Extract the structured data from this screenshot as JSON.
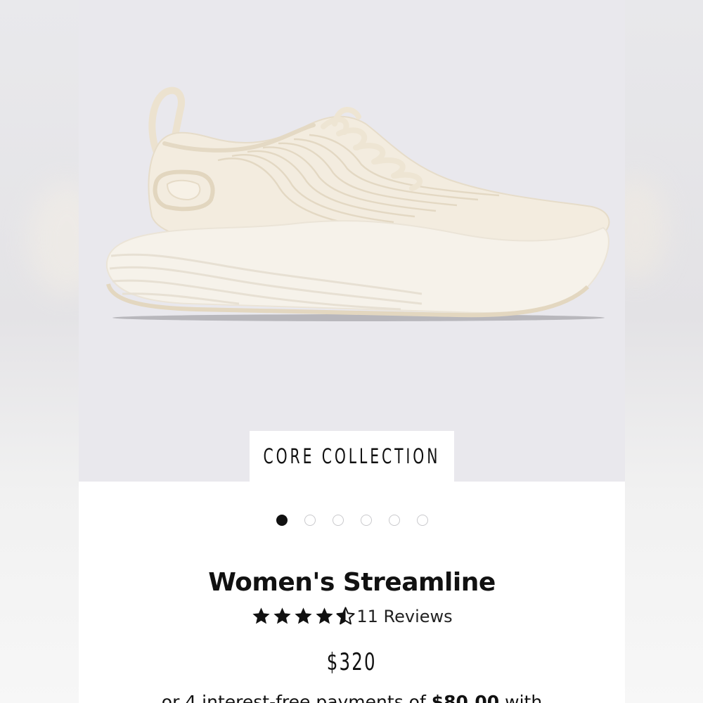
{
  "product": {
    "collection_tag": "CORE COLLECTION",
    "name": "Women's Streamline",
    "rating": 4.5,
    "rating_max": 5,
    "reviews_label": "11 Reviews",
    "price": "$320",
    "installments_prefix": "or 4 interest-free payments of ",
    "installment_amount": "$80.00",
    "installments_suffix": " with"
  },
  "gallery": {
    "image_count": 6,
    "active_index": 0,
    "image_icon": "sneaker-product-photo"
  },
  "colors": {
    "hero_background": "#e9e8ed",
    "shoe_body": "#f3ecdf",
    "text": "#111111",
    "dot_inactive_border": "#c9c9cc"
  }
}
